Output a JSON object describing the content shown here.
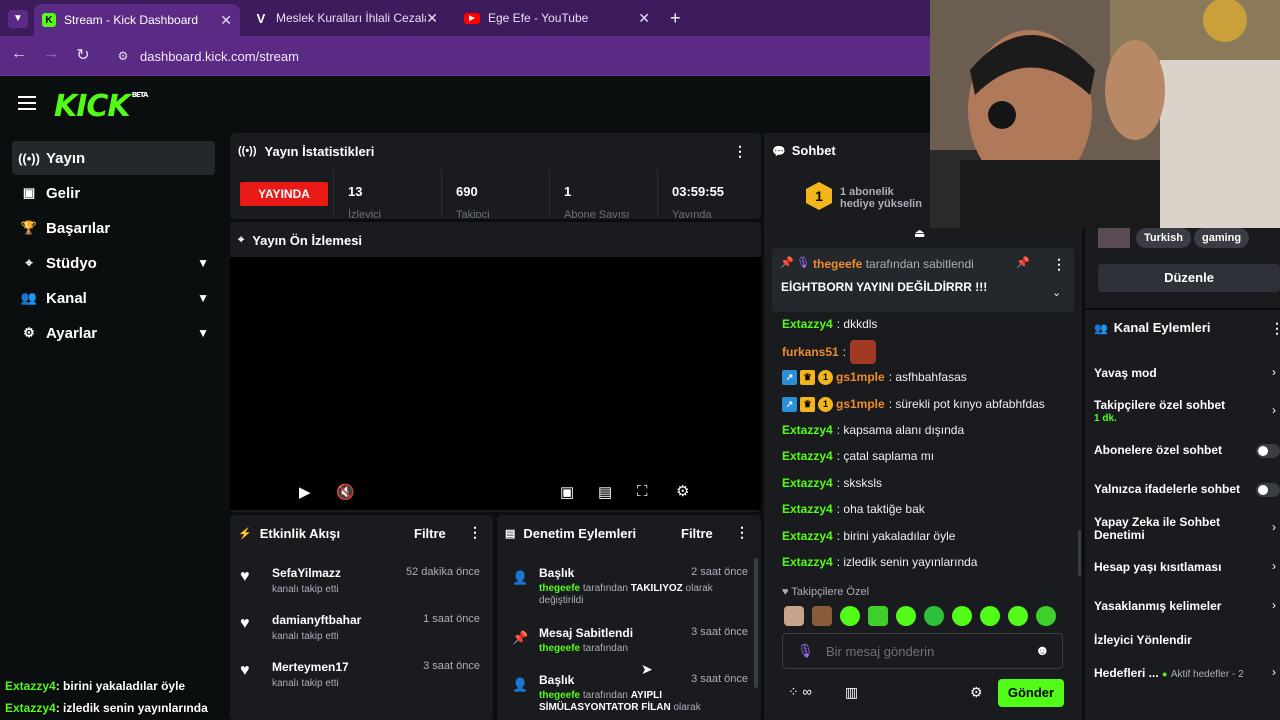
{
  "browser": {
    "tabs": [
      {
        "title": "Stream - Kick Dashboard",
        "active": true
      },
      {
        "title": "Meslek Kuralları İhlali Cezaları",
        "active": false
      },
      {
        "title": "Ege Efe - YouTube",
        "active": false
      }
    ],
    "url": "dashboard.kick.com/stream"
  },
  "colors": {
    "accent": "#53fc18",
    "live": "#e91916",
    "browser": "#5a2a85",
    "panel": "#191b1f"
  },
  "logo": {
    "text": "KICK",
    "badge": "BETA"
  },
  "sidebar": {
    "items": [
      {
        "label": "Yayın",
        "icon": "broadcast-icon",
        "active": true
      },
      {
        "label": "Gelir",
        "icon": "chart-icon"
      },
      {
        "label": "Başarılar",
        "icon": "trophy-icon"
      },
      {
        "label": "Stüdyo",
        "icon": "studio-icon",
        "expandable": true
      },
      {
        "label": "Kanal",
        "icon": "people-icon",
        "expandable": true
      },
      {
        "label": "Ayarlar",
        "icon": "gear-icon",
        "expandable": true
      }
    ]
  },
  "stats": {
    "title": "Yayın İstatistikleri",
    "live_label": "YAYINDA",
    "items": [
      {
        "value": "13",
        "label": "İzleyici"
      },
      {
        "value": "690",
        "label": "Takipçi"
      },
      {
        "value": "1",
        "label": "Abone Sayısı"
      },
      {
        "value": "03:59:55",
        "label": "Yayında"
      }
    ]
  },
  "preview": {
    "title": "Yayın Ön İzlemesi"
  },
  "activity": {
    "title": "Etkinlik Akışı",
    "filter": "Filtre",
    "rows": [
      {
        "name": "SefaYilmazz",
        "sub": "kanalı takip etti",
        "time": "52 dakika önce"
      },
      {
        "name": "damianyftbahar",
        "sub": "kanalı takip etti",
        "time": "1 saat önce"
      },
      {
        "name": "Merteymen17",
        "sub": "kanalı takip etti",
        "time": "3 saat önce"
      }
    ]
  },
  "moderation": {
    "title": "Denetim Eylemleri",
    "filter": "Filtre",
    "rows": [
      {
        "title": "Başlık",
        "by": "thegeefe",
        "mid": "tarafından",
        "value": "TAKILIYOZ",
        "end": "olarak değiştirildi",
        "time": "2 saat önce"
      },
      {
        "title": "Mesaj Sabitlendi",
        "by": "thegeefe",
        "mid": "tarafından",
        "value": "",
        "end": "",
        "time": "3 saat önce"
      },
      {
        "title": "Başlık",
        "by": "thegeefe",
        "mid": "tarafından",
        "value": "AYIPLI SİMÜLASYONTATOR FİLAN",
        "end": "olarak",
        "time": "3 saat önce"
      }
    ]
  },
  "chat": {
    "title": "Sohbet",
    "gift_text": "1 abonelik hediye yükselin",
    "pinned_by": "thegeefe",
    "pinned_suffix": "tarafından sabitlendi",
    "pinned_message": "EİGHTBORN YAYINI DEĞİLDİRRR !!!",
    "messages": [
      {
        "user": "Extazzy4",
        "color": "#53fc18",
        "text": "dkkdls"
      },
      {
        "user": "furkans51",
        "color": "#f08b2e",
        "text": ""
      },
      {
        "user": "gs1mple",
        "color": "#f08b2e",
        "text": "asfhbahfasas"
      },
      {
        "user": "gs1mple",
        "color": "#f08b2e",
        "text": "sürekli pot kınyo abfabhfdas"
      },
      {
        "user": "Extazzy4",
        "color": "#53fc18",
        "text": "kapsama alanı dışında"
      },
      {
        "user": "Extazzy4",
        "color": "#53fc18",
        "text": "çatal saplama mı"
      },
      {
        "user": "Extazzy4",
        "color": "#53fc18",
        "text": "sksksls"
      },
      {
        "user": "Extazzy4",
        "color": "#53fc18",
        "text": "oha taktiğe bak"
      },
      {
        "user": "Extazzy4",
        "color": "#53fc18",
        "text": "birini yakaladılar öyle"
      },
      {
        "user": "Extazzy4",
        "color": "#53fc18",
        "text": "izledik senin yayınlarında"
      }
    ],
    "emote_label": "Takipçilere Özel",
    "input_placeholder": "Bir mesaj gönderin",
    "send": "Gönder"
  },
  "right": {
    "tags": [
      "Turkish",
      "gaming"
    ],
    "edit": "Düzenle",
    "actions_title": "Kanal Eylemleri",
    "actions": [
      {
        "label": "Yavaş mod",
        "sub": "",
        "control": "chevron"
      },
      {
        "label": "Takipçilere özel sohbet",
        "sub": "1 dk.",
        "control": "chevron"
      },
      {
        "label": "Abonelere özel sohbet",
        "sub": "",
        "control": "toggle"
      },
      {
        "label": "Yalnızca ifadelerle sohbet",
        "sub": "",
        "control": "toggle"
      },
      {
        "label": "Yapay Zeka ile Sohbet Denetimi",
        "sub": "",
        "control": "chevron"
      },
      {
        "label": "Hesap yaşı kısıtlaması",
        "sub": "",
        "control": "chevron"
      },
      {
        "label": "Yasaklanmış kelimeler",
        "sub": "",
        "control": "chevron"
      },
      {
        "label": "İzleyici Yönlendir",
        "sub": "",
        "control": "none"
      },
      {
        "label": "Hedefleri ...",
        "sub": "Aktif hedefler - 2",
        "control": "chevron"
      }
    ]
  },
  "overlay": [
    {
      "user": "Extazzy4",
      "text": ": birini yakaladılar öyle"
    },
    {
      "user": "Extazzy4",
      "text": ": izledik senin yayınlarında"
    }
  ]
}
